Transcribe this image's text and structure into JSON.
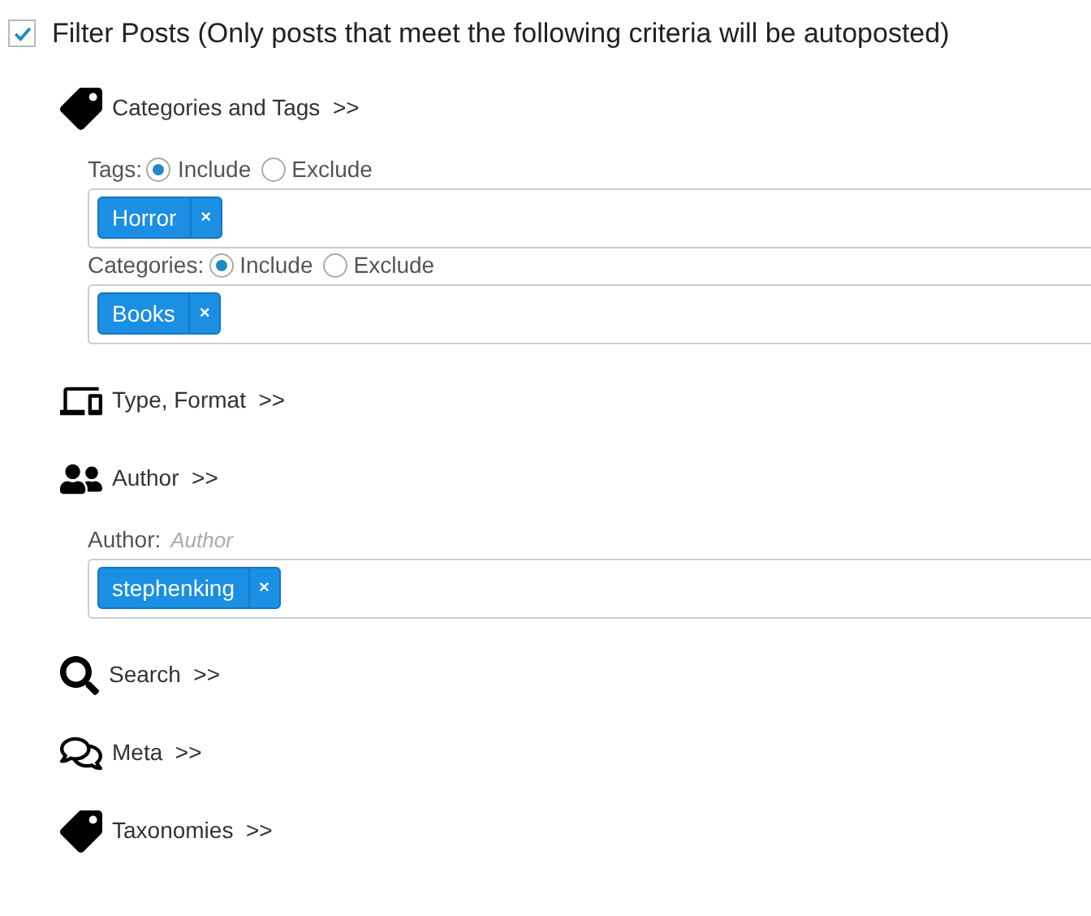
{
  "filter": {
    "checked": true,
    "label": "Filter Posts (Only posts that meet the following criteria will be autoposted)"
  },
  "sections": [
    {
      "kind": "tag",
      "title": "Categories and Tags",
      "toggle": ">>",
      "fields": [
        {
          "label": "Tags:",
          "options": [
            {
              "label": "Include",
              "selected": true
            },
            {
              "label": "Exclude",
              "selected": false
            }
          ],
          "tags": [
            {
              "label": "Horror",
              "remove": "×"
            }
          ]
        },
        {
          "label": "Categories:",
          "options": [
            {
              "label": "Include",
              "selected": true
            },
            {
              "label": "Exclude",
              "selected": false
            }
          ],
          "tags": [
            {
              "label": "Books",
              "remove": "×"
            }
          ]
        }
      ]
    },
    {
      "kind": "devices",
      "title": "Type, Format",
      "toggle": ">>"
    },
    {
      "kind": "users",
      "title": "Author",
      "toggle": ">>",
      "fields": [
        {
          "label": "Author:",
          "placeholder": "Author",
          "tags": [
            {
              "label": "stephenking",
              "remove": "×"
            }
          ]
        }
      ]
    },
    {
      "kind": "search",
      "title": "Search",
      "toggle": ">>"
    },
    {
      "kind": "comments",
      "title": "Meta",
      "toggle": ">>"
    },
    {
      "kind": "tag",
      "title": "Taxonomies",
      "toggle": ">>"
    }
  ]
}
